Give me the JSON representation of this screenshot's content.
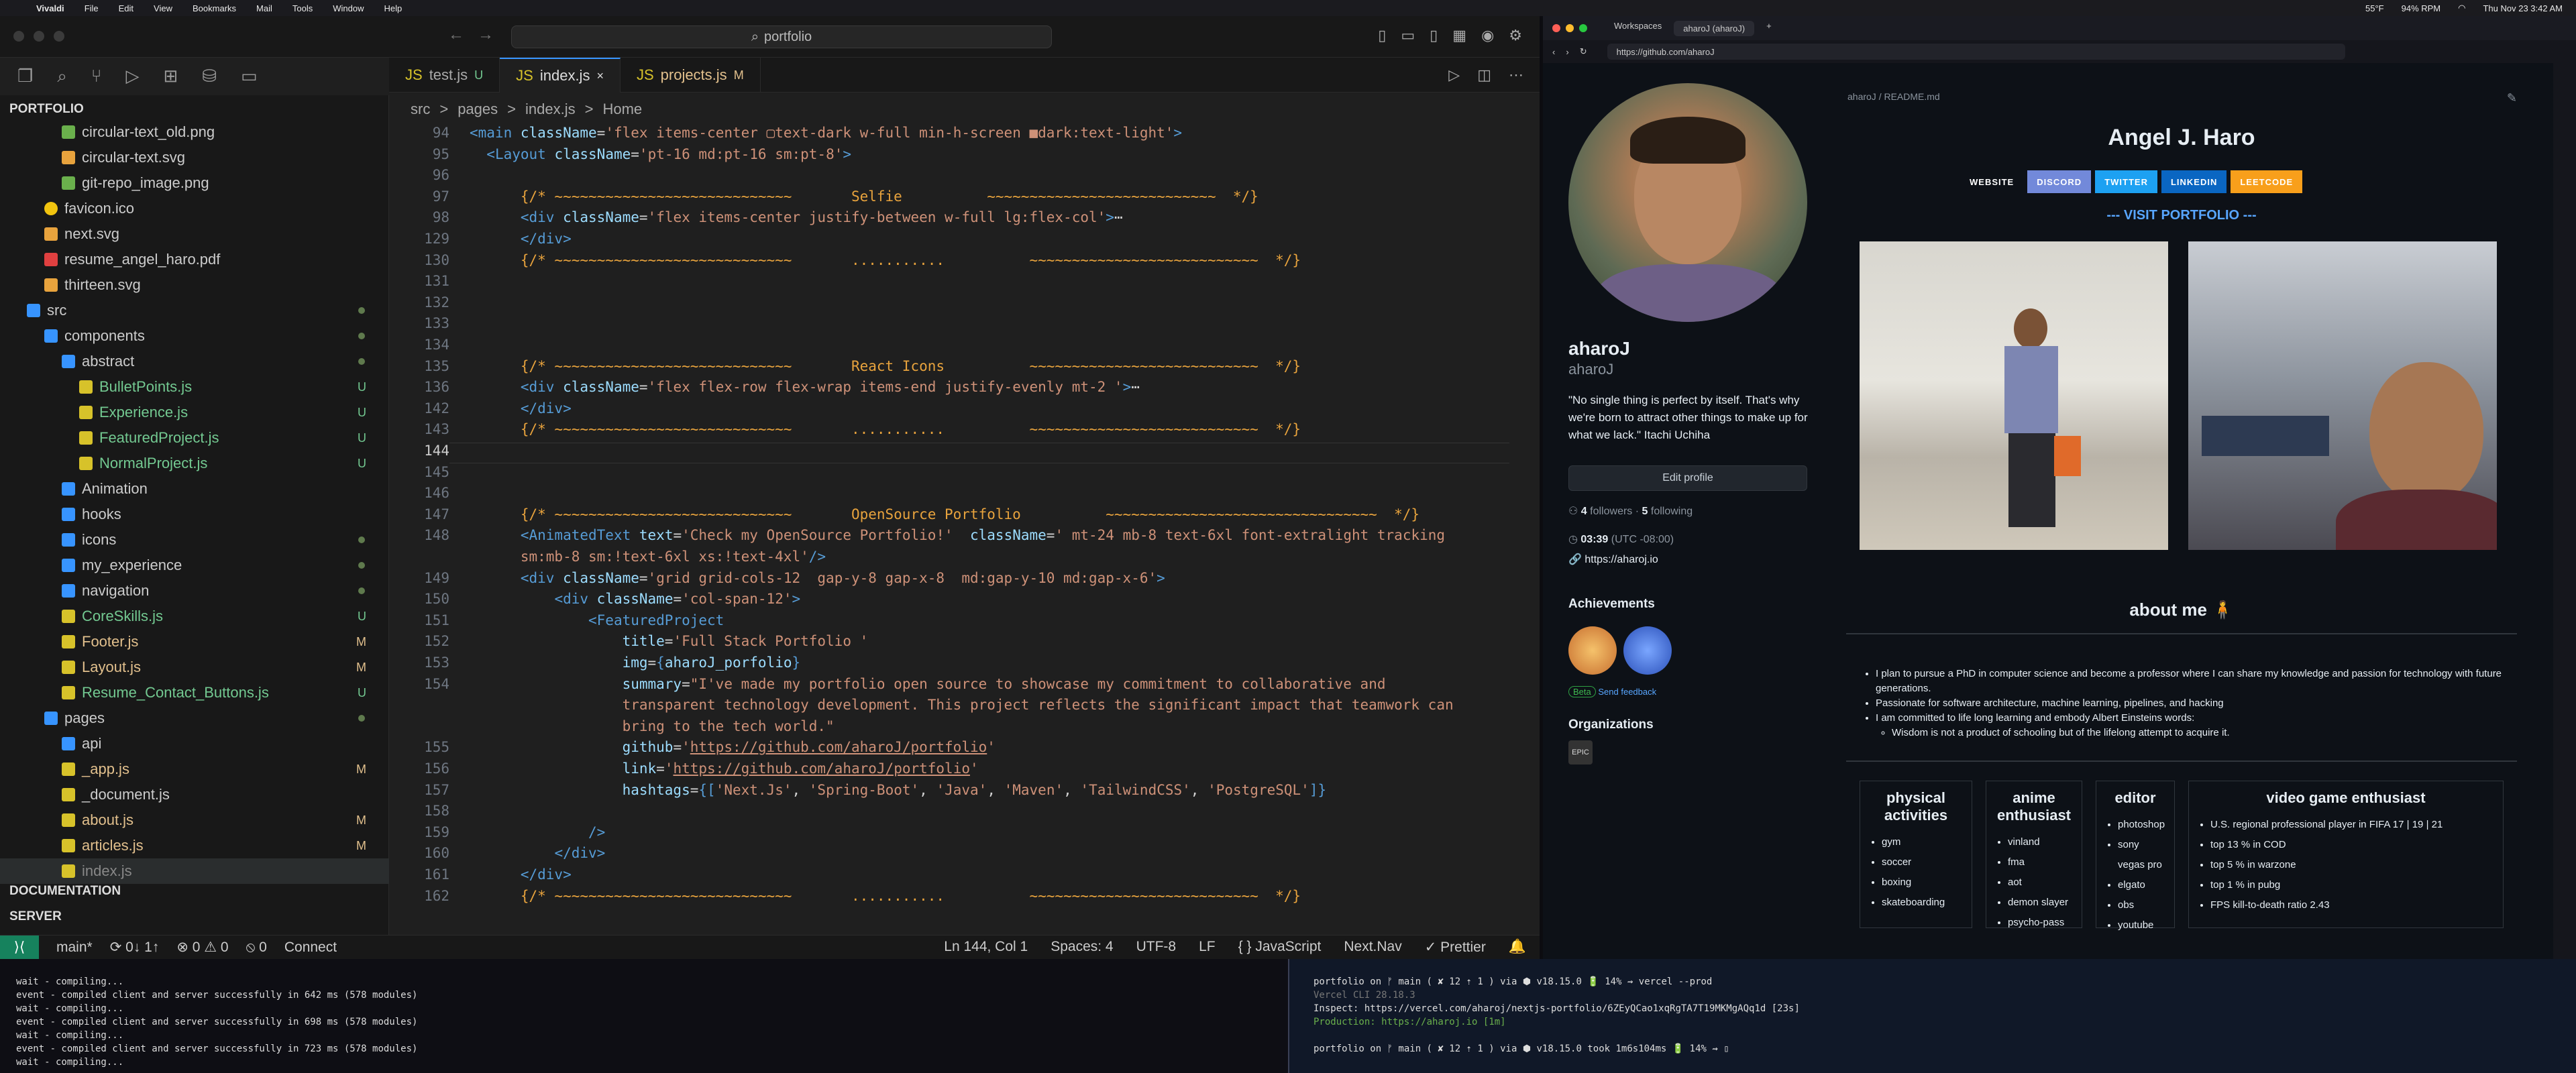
{
  "menubar": {
    "app": "Vivaldi",
    "items": [
      "File",
      "Edit",
      "View",
      "Bookmarks",
      "Mail",
      "Tools",
      "Window",
      "Help"
    ],
    "weather": "55°F",
    "cpu": "94% RPM",
    "datetime": "Thu Nov 23  3:42 AM"
  },
  "vscode": {
    "search": "portfolio",
    "explorer": {
      "root": "PORTFOLIO",
      "rows": [
        {
          "label": "circular-text_old.png",
          "type": "img",
          "indent": 1
        },
        {
          "label": "circular-text.svg",
          "type": "svg",
          "indent": 1
        },
        {
          "label": "git-repo_image.png",
          "type": "img",
          "indent": 1
        },
        {
          "label": "favicon.ico",
          "type": "star",
          "indent": 0
        },
        {
          "label": "next.svg",
          "type": "svg",
          "indent": 0
        },
        {
          "label": "resume_angel_haro.pdf",
          "type": "pdf",
          "indent": 0
        },
        {
          "label": "thirteen.svg",
          "type": "svg",
          "indent": 0
        },
        {
          "label": "src",
          "type": "folder",
          "indent": -1,
          "status": "dot"
        },
        {
          "label": "components",
          "type": "folder",
          "indent": 0,
          "status": "dot"
        },
        {
          "label": "abstract",
          "type": "folder",
          "indent": 1,
          "status": "dot"
        },
        {
          "label": "BulletPoints.js",
          "type": "js",
          "indent": 2,
          "status": "U"
        },
        {
          "label": "Experience.js",
          "type": "js",
          "indent": 2,
          "status": "U"
        },
        {
          "label": "FeaturedProject.js",
          "type": "js",
          "indent": 2,
          "status": "U"
        },
        {
          "label": "NormalProject.js",
          "type": "js",
          "indent": 2,
          "status": "U"
        },
        {
          "label": "Animation",
          "type": "folder",
          "indent": 1
        },
        {
          "label": "hooks",
          "type": "folder",
          "indent": 1
        },
        {
          "label": "icons",
          "type": "folder",
          "indent": 1,
          "status": "dot"
        },
        {
          "label": "my_experience",
          "type": "folder",
          "indent": 1,
          "status": "dot"
        },
        {
          "label": "navigation",
          "type": "folder",
          "indent": 1,
          "status": "dot"
        },
        {
          "label": "CoreSkills.js",
          "type": "js",
          "indent": 1,
          "status": "U"
        },
        {
          "label": "Footer.js",
          "type": "js",
          "indent": 1,
          "status": "M"
        },
        {
          "label": "Layout.js",
          "type": "js",
          "indent": 1,
          "status": "M"
        },
        {
          "label": "Resume_Contact_Buttons.js",
          "type": "js",
          "indent": 1,
          "status": "U"
        },
        {
          "label": "pages",
          "type": "folder",
          "indent": 0,
          "status": "dot"
        },
        {
          "label": "api",
          "type": "folder",
          "indent": 1
        },
        {
          "label": "_app.js",
          "type": "js",
          "indent": 1,
          "status": "M"
        },
        {
          "label": "_document.js",
          "type": "js",
          "indent": 1
        },
        {
          "label": "about.js",
          "type": "js",
          "indent": 1,
          "status": "M"
        },
        {
          "label": "articles.js",
          "type": "js",
          "indent": 1,
          "status": "M"
        },
        {
          "label": "index.js",
          "type": "js",
          "indent": 1,
          "dim": true
        }
      ],
      "sections": [
        "DOCUMENTATION",
        "SERVER"
      ]
    },
    "tabs": [
      {
        "label": "test.js",
        "mod": "U",
        "active": false
      },
      {
        "label": "index.js",
        "mod": "×",
        "active": true
      },
      {
        "label": "projects.js",
        "mod": "M",
        "active": false
      }
    ],
    "breadcrumb": [
      "src",
      ">",
      "pages",
      ">",
      "index.js",
      ">",
      "Home"
    ],
    "lines": [
      {
        "n": "94",
        "h": "<span class='t'>&lt;main</span> <span class='a'>className</span>=<span class='s'>'flex items-center ▢text-dark w-full min-h-screen ■dark:text-light'</span><span class='t'>&gt;</span>"
      },
      {
        "n": "95",
        "h": "  <span class='t'>&lt;Layout</span> <span class='a'>className</span>=<span class='s'>'pt-16 md:pt-16 sm:pt-8'</span><span class='t'>&gt;</span>"
      },
      {
        "n": "96",
        "h": ""
      },
      {
        "n": "97",
        "h": "      <span class='o'>{/* ~~~~~~~~~~~~~~~~~~~~~~~~~~~~       Selfie          ~~~~~~~~~~~~~~~~~~~~~~~~~~~  */}</span>"
      },
      {
        "n": "98",
        "h": "      <span class='t'>&lt;div</span> <span class='a'>className</span>=<span class='s'>'flex items-center justify-between w-full lg:flex-col'</span><span class='t'>&gt;</span><span class='p'>⋯</span>"
      },
      {
        "n": "129",
        "h": "      <span class='t'>&lt;/div&gt;</span>"
      },
      {
        "n": "130",
        "h": "      <span class='o'>{/* ~~~~~~~~~~~~~~~~~~~~~~~~~~~~       ...........          ~~~~~~~~~~~~~~~~~~~~~~~~~~~  */}</span>"
      },
      {
        "n": "131",
        "h": ""
      },
      {
        "n": "132",
        "h": ""
      },
      {
        "n": "133",
        "h": ""
      },
      {
        "n": "134",
        "h": ""
      },
      {
        "n": "135",
        "h": "      <span class='o'>{/* ~~~~~~~~~~~~~~~~~~~~~~~~~~~~       React Icons          ~~~~~~~~~~~~~~~~~~~~~~~~~~~  */}</span>"
      },
      {
        "n": "136",
        "h": "      <span class='t'>&lt;div</span> <span class='a'>className</span>=<span class='s'>'flex flex-row flex-wrap items-end justify-evenly mt-2 '</span><span class='t'>&gt;</span><span class='p'>⋯</span>"
      },
      {
        "n": "142",
        "h": "      <span class='t'>&lt;/div&gt;</span>"
      },
      {
        "n": "143",
        "h": "      <span class='o'>{/* ~~~~~~~~~~~~~~~~~~~~~~~~~~~~       ...........          ~~~~~~~~~~~~~~~~~~~~~~~~~~~  */}</span>"
      },
      {
        "n": "144",
        "h": ""
      },
      {
        "n": "145",
        "h": ""
      },
      {
        "n": "146",
        "h": ""
      },
      {
        "n": "147",
        "h": "      <span class='o'>{/* ~~~~~~~~~~~~~~~~~~~~~~~~~~~~       OpenSource Portfolio          ~~~~~~~~~~~~~~~~~~~~~~~~~~~~~~~~  */}</span>"
      },
      {
        "n": "148",
        "h": "      <span class='t'>&lt;AnimatedText</span> <span class='a'>text</span>=<span class='s'>'Check my OpenSource Portfolio!'</span>  <span class='a'>className</span>=<span class='s'>' mt-24 mb-8 text-6xl font-extralight tracking</span>"
      },
      {
        "n": "",
        "h": "      <span class='s'>sm:mb-8 sm:!text-6xl xs:!text-4xl'</span><span class='t'>/&gt;</span>"
      },
      {
        "n": "149",
        "h": "      <span class='t'>&lt;div</span> <span class='a'>className</span>=<span class='s'>'grid grid-cols-12  gap-y-8 gap-x-8  md:gap-y-10 md:gap-x-6'</span><span class='t'>&gt;</span>"
      },
      {
        "n": "150",
        "h": "          <span class='t'>&lt;div</span> <span class='a'>className</span>=<span class='s'>'col-span-12'</span><span class='t'>&gt;</span>"
      },
      {
        "n": "151",
        "h": "              <span class='t'>&lt;FeaturedProject</span>"
      },
      {
        "n": "152",
        "h": "                  <span class='a'>title</span>=<span class='s'>'Full Stack Portfolio '</span>"
      },
      {
        "n": "153",
        "h": "                  <span class='a'>img</span>=<span class='t'>{</span><span class='a'>aharoJ_porfolio</span><span class='t'>}</span>"
      },
      {
        "n": "154",
        "h": "                  <span class='a'>summary</span>=<span class='s'>\"I've made my portfolio open source to showcase my commitment to collaborative and</span>"
      },
      {
        "n": "",
        "h": "                  <span class='s'>transparent technology development. This project reflects the significant impact that teamwork can</span>"
      },
      {
        "n": "",
        "h": "                  <span class='s'>bring to the tech world.\"</span>"
      },
      {
        "n": "155",
        "h": "                  <span class='a'>github</span>=<span class='s'>'<u>https://github.com/aharoJ/portfolio</u>'</span>"
      },
      {
        "n": "156",
        "h": "                  <span class='a'>link</span>=<span class='s'>'<u>https://github.com/aharoJ/portfolio</u>'</span>"
      },
      {
        "n": "157",
        "h": "                  <span class='a'>hashtags</span>=<span class='t'>{[</span><span class='s'>'Next.Js'</span>, <span class='s'>'Spring-Boot'</span>, <span class='s'>'Java'</span>, <span class='s'>'Maven'</span>, <span class='s'>'TailwindCSS'</span>, <span class='s'>'PostgreSQL'</span><span class='t'>]}</span>"
      },
      {
        "n": "158",
        "h": ""
      },
      {
        "n": "159",
        "h": "              <span class='t'>/&gt;</span>"
      },
      {
        "n": "160",
        "h": "          <span class='t'>&lt;/div&gt;</span>"
      },
      {
        "n": "161",
        "h": "      <span class='t'>&lt;/div&gt;</span>"
      },
      {
        "n": "162",
        "h": "      <span class='o'>{/* ~~~~~~~~~~~~~~~~~~~~~~~~~~~~       ...........          ~~~~~~~~~~~~~~~~~~~~~~~~~~~  */}</span>"
      }
    ],
    "status": {
      "branch": "main*",
      "sync": "⟳ 0↓ 1↑",
      "problems": "⊗ 0 ⚠ 0",
      "ports": "⦸ 0",
      "connect": "Connect",
      "position": "Ln 144, Col 1",
      "spaces": "Spaces: 4",
      "encoding": "UTF-8",
      "eol": "LF",
      "lang": "{ } JavaScript",
      "nav": "Next.Nav",
      "prettier": "✓ Prettier"
    }
  },
  "browser": {
    "tabs": [
      "Workspaces",
      "aharoJ (aharoJ)"
    ],
    "url": "https://github.com/aharoJ",
    "profile": {
      "name": "aharoJ",
      "username": "aharoJ",
      "bio": "\"No single thing is perfect by itself. That's why we're born to attract other things to make up for what we lack.\" Itachi Uchiha",
      "edit": "Edit profile",
      "followers": "4",
      "followers_label": "followers",
      "following": "5",
      "following_label": "following",
      "time": "03:39",
      "tz": "(UTC -08:00)",
      "site": "https://aharoj.io",
      "achievements": "Achievements",
      "beta": "Beta",
      "feedback": "Send feedback",
      "orgs": "Organizations"
    },
    "readme": {
      "path": "aharoJ / README.md",
      "title": "Angel J. Haro",
      "socials": [
        {
          "label": "WEBSITE",
          "color": "#0d1117"
        },
        {
          "label": "DISCORD",
          "color": "#7289da"
        },
        {
          "label": "TWITTER",
          "color": "#1da1f2"
        },
        {
          "label": "LINKEDIN",
          "color": "#0a66c2"
        },
        {
          "label": "LEETCODE",
          "color": "#f89f1b"
        }
      ],
      "visit": "--- VISIT PORTFOLIO ---",
      "about": "about me 🧍",
      "bullets": [
        "I plan to pursue a PhD in computer science and become a professor where I can share my knowledge and passion for technology with future generations.",
        "Passionate for software architecture, machine learning, pipelines, and hacking",
        "I am committed to life long learning and embody Albert Einsteins words:"
      ],
      "quote": "Wisdom is not a product of schooling but of the lifelong attempt to acquire it.",
      "cards": [
        {
          "title": "physical activities",
          "items": [
            "gym",
            "soccer",
            "boxing",
            "skateboarding"
          ]
        },
        {
          "title": "anime enthusiast",
          "items": [
            "vinland",
            "fma",
            "aot",
            "demon slayer",
            "psycho-pass"
          ]
        },
        {
          "title": "editor",
          "items": [
            "photoshop",
            "sony vegas pro",
            "elgato",
            "obs",
            "youtube"
          ]
        },
        {
          "title": "video game enthusiast",
          "items": [
            "U.S. regional professional player in FIFA 17 | 19 | 21",
            "top 13 % in COD",
            "top 5 % in warzone",
            "top 1 % in pubg",
            "FPS kill-to-death ratio 2.43"
          ]
        }
      ]
    }
  },
  "terminal_left": [
    "wait  - compiling...",
    "event - compiled client and server successfully in 642 ms (578 modules)",
    "wait  - compiling...",
    "event - compiled client and server successfully in 698 ms (578 modules)",
    "wait  - compiling...",
    "event - compiled client and server successfully in 723 ms (578 modules)",
    "wait  - compiling..."
  ],
  "terminal_right": {
    "prompt1": "portfolio on ᚠ main ( ✘ 12 ⇡ 1 ) via ⬢ v18.15.0 🔋 14%  ⇝  vercel --prod",
    "cli": "Vercel CLI 28.18.3",
    "inspect": "Inspect: https://vercel.com/aharoj/nextjs-portfolio/6ZEyQCao1xqRgTA7T19MKMgAQq1d [23s]",
    "production": "Production: https://aharoj.io [1m]",
    "prompt2": "portfolio on ᚠ main ( ✘ 12 ⇡ 1 ) via ⬢ v18.15.0 took 1m6s104ms 🔋 14%  ⇝  ▯"
  }
}
